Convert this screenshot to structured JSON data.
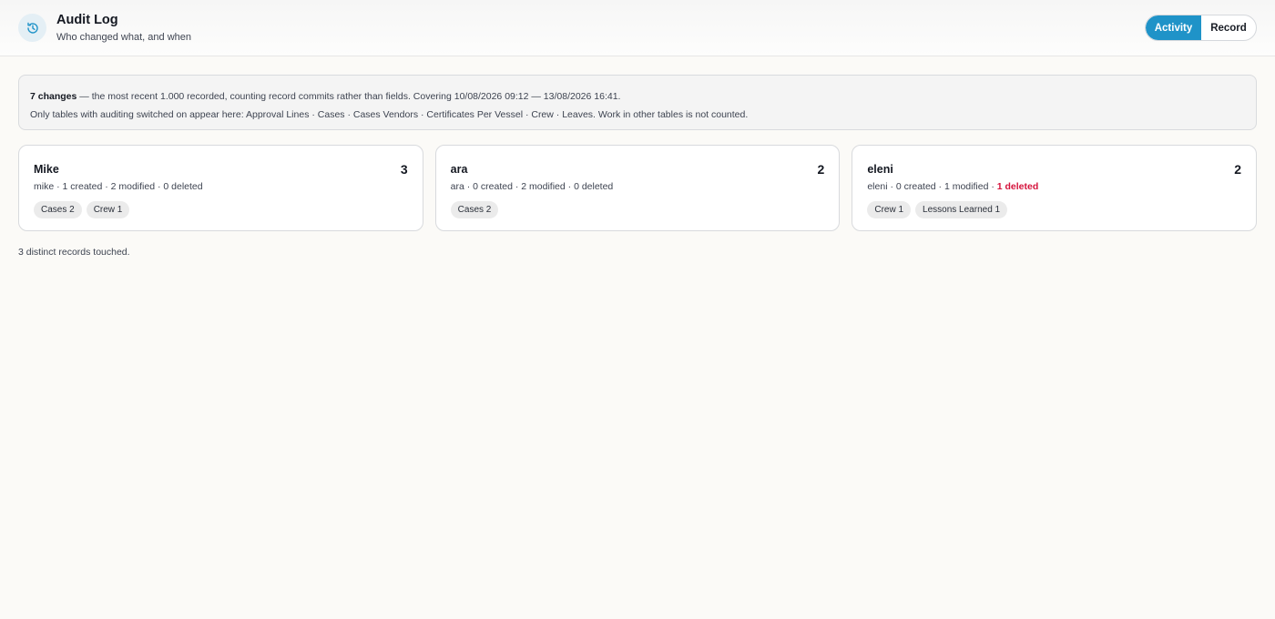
{
  "header": {
    "title": "Audit Log",
    "subtitle": "Who changed what, and when",
    "icon": "history-icon",
    "tabs": [
      {
        "label": "Activity",
        "active": true
      },
      {
        "label": "Record",
        "active": false
      }
    ]
  },
  "summary": {
    "changes_bold": "7 changes",
    "line1_rest": " — the most recent 1.000 recorded, counting record commits rather than fields. Covering 10/08/2026 09:12 — 13/08/2026 16:41.",
    "line2": "Only tables with auditing switched on appear here: Approval Lines · Cases · Cases Vendors · Certificates Per Vessel · Crew · Leaves. Work in other tables is not counted."
  },
  "users": [
    {
      "name": "Mike",
      "count": "3",
      "stats": "mike · 1 created · 2 modified · 0 deleted",
      "stats_deleted": "",
      "chips": [
        "Cases 2",
        "Crew 1"
      ]
    },
    {
      "name": "ara",
      "count": "2",
      "stats": "ara · 0 created · 2 modified · 0 deleted",
      "stats_deleted": "",
      "chips": [
        "Cases 2"
      ]
    },
    {
      "name": "eleni",
      "count": "2",
      "stats": "eleni · 0 created · 1 modified · ",
      "stats_deleted": "1 deleted",
      "chips": [
        "Crew 1",
        "Lessons Learned 1"
      ]
    }
  ],
  "footer": {
    "note": "3 distinct records touched."
  },
  "colors": {
    "accent": "#1f93c8",
    "deleted": "#d5143d"
  }
}
